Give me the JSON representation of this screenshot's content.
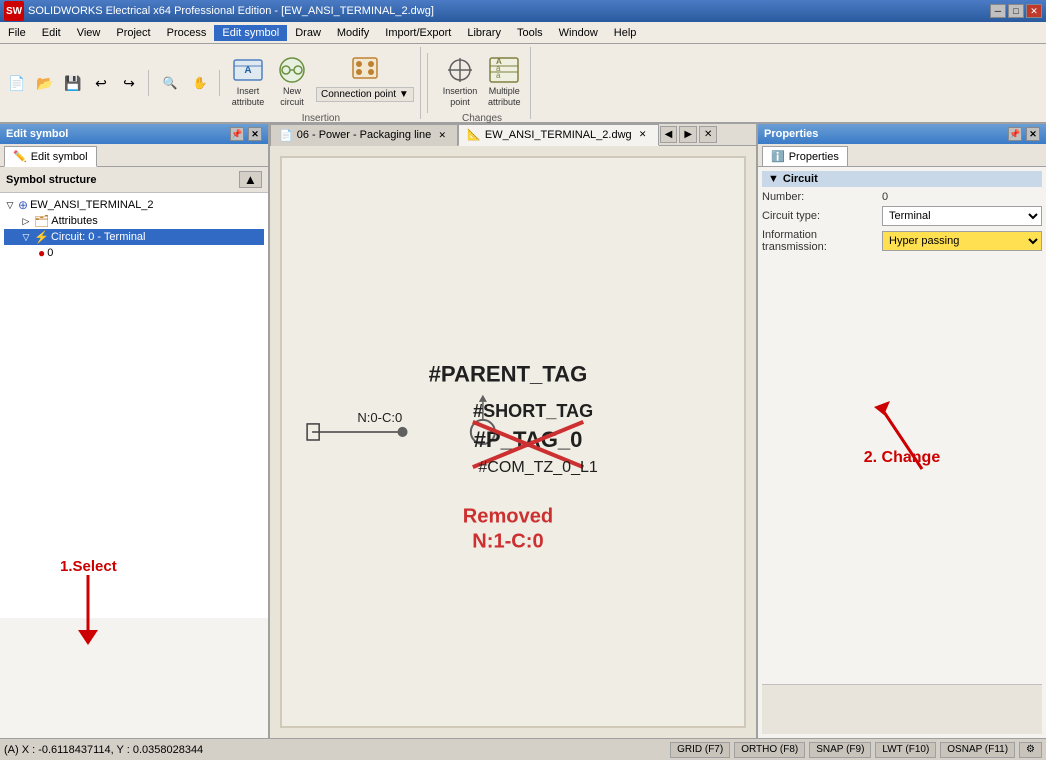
{
  "titlebar": {
    "title": "SOLIDWORKS Electrical x64 Professional Edition - [EW_ANSI_TERMINAL_2.dwg]",
    "logo": "SW"
  },
  "menubar": {
    "items": [
      "File",
      "Edit",
      "View",
      "Project",
      "Process",
      "Edit symbol",
      "Draw",
      "Modify",
      "Import/Export",
      "Library",
      "Tools",
      "Window",
      "Help"
    ]
  },
  "toolbar": {
    "active_tab": "Edit symbol",
    "insertion_group": {
      "label": "Insertion",
      "buttons": [
        {
          "id": "insert-attribute",
          "label": "Insert\nattribute",
          "icon": "📝"
        },
        {
          "id": "new-circuit",
          "label": "New\ncircuit",
          "icon": "⚡"
        },
        {
          "id": "multiple-connection-points",
          "label": "Multiple\nconnection points",
          "icon": "🔗"
        }
      ],
      "connection_point_btn": "Connection point ▼"
    },
    "changes_group": {
      "label": "Changes",
      "buttons": [
        {
          "id": "insertion-point",
          "label": "Insertion\npoint",
          "icon": "⊕"
        },
        {
          "id": "multiple-attribute",
          "label": "Multiple\nattribute",
          "icon": "📋"
        }
      ]
    }
  },
  "left_panel": {
    "title": "Edit symbol",
    "tab": "Edit symbol",
    "structure_header": "Symbol structure",
    "tree": {
      "root": "EW_ANSI_TERMINAL_2",
      "children": [
        {
          "label": "Attributes",
          "expanded": false
        },
        {
          "label": "Circuit: 0 - Terminal",
          "selected": true,
          "children": [
            {
              "label": "0"
            }
          ]
        }
      ]
    }
  },
  "annotation1": {
    "text": "1.Select",
    "arrow": "↑"
  },
  "tabs": [
    {
      "label": "06 - Power - Packaging line",
      "active": false,
      "icon": "📄"
    },
    {
      "label": "EW_ANSI_TERMINAL_2.dwg",
      "active": true,
      "icon": "📐"
    }
  ],
  "drawing": {
    "parent_tag": "#PARENT_TAG",
    "short_tag": "#SHORT_TAG",
    "p_tag": "#P_TAG_0",
    "com_tz": "#COM_TZ_0_L1",
    "n0c0": "N:0-C:0",
    "removed_label": "Removed",
    "removed_n": "N:1-C:0"
  },
  "right_panel": {
    "title": "Properties",
    "tab": "Properties",
    "section": "Circuit",
    "fields": {
      "number_label": "Number:",
      "number_value": "0",
      "circuit_type_label": "Circuit type:",
      "circuit_type_value": "Terminal",
      "info_transmission_label": "Information transmission:",
      "info_transmission_value": "Hyper passing"
    }
  },
  "annotation2": {
    "text": "2. Change",
    "arrow": "↑"
  },
  "status_bar": {
    "coords": "(A) X : -0.6118437114, Y : 0.0358028344",
    "grid": "GRID (F7)",
    "ortho": "ORTHO (F8)",
    "snap": "SNAP (F9)",
    "lwt": "LWT (F10)",
    "osnap": "OSNAP (F11)"
  }
}
